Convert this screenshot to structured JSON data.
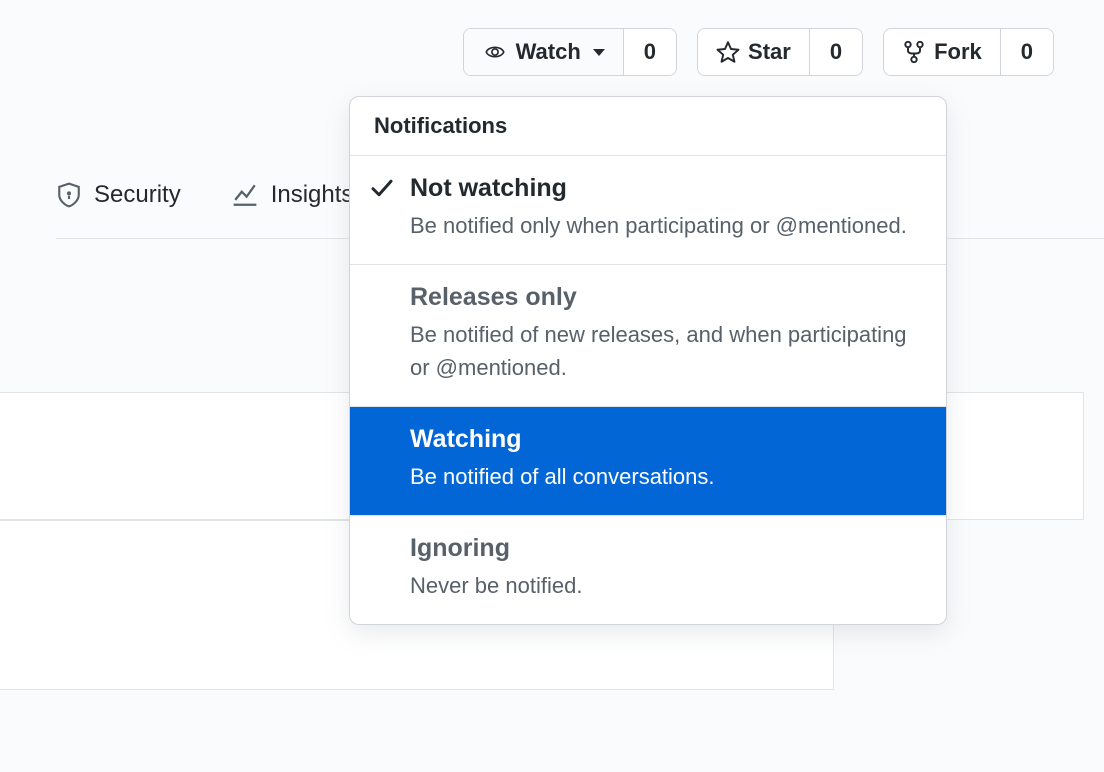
{
  "actions": {
    "watch": {
      "label": "Watch",
      "count": "0"
    },
    "star": {
      "label": "Star",
      "count": "0"
    },
    "fork": {
      "label": "Fork",
      "count": "0"
    }
  },
  "nav": {
    "security": "Security",
    "insights": "Insights"
  },
  "dropdown": {
    "header": "Notifications",
    "items": [
      {
        "title": "Not watching",
        "desc": "Be notified only when participating or @mentioned.",
        "checked": true,
        "selected": false
      },
      {
        "title": "Releases only",
        "desc": "Be notified of new releases, and when participating or @mentioned.",
        "checked": false,
        "selected": false
      },
      {
        "title": "Watching",
        "desc": "Be notified of all conversations.",
        "checked": false,
        "selected": true
      },
      {
        "title": "Ignoring",
        "desc": "Never be notified.",
        "checked": false,
        "selected": false
      }
    ]
  }
}
